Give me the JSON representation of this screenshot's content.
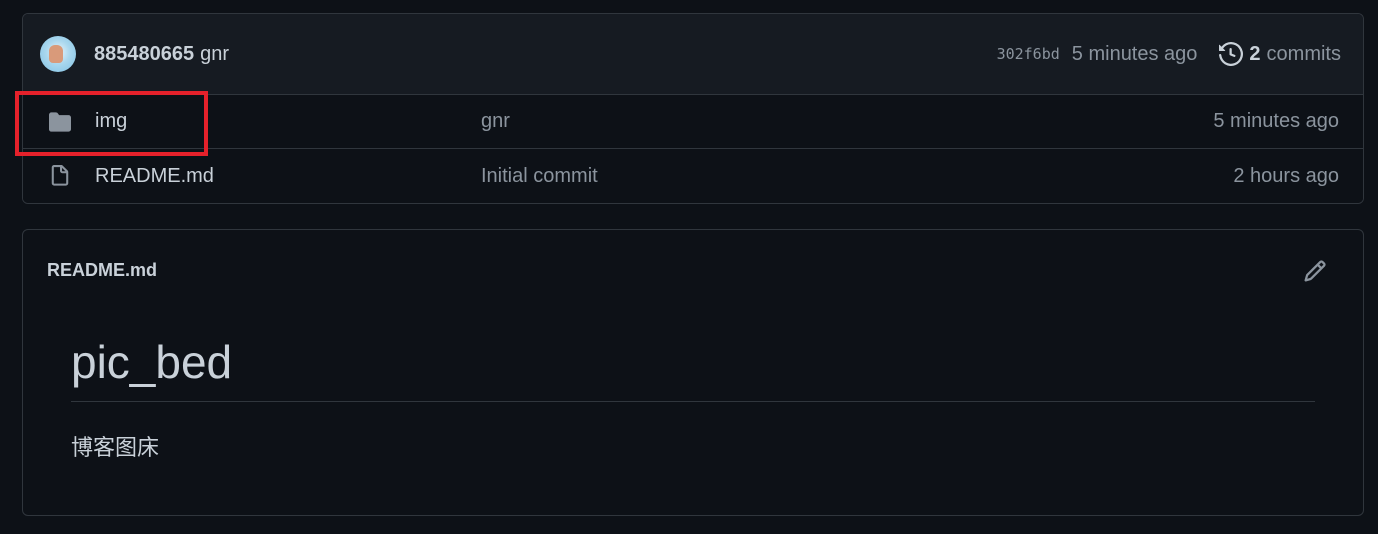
{
  "commit": {
    "author": "885480665",
    "message": "gnr",
    "sha": "302f6bd",
    "time": "5 minutes ago",
    "commit_count": "2",
    "commits_label": "commits"
  },
  "files": [
    {
      "name": "img",
      "type": "folder",
      "message": "gnr",
      "age": "5 minutes ago"
    },
    {
      "name": "README.md",
      "type": "file",
      "message": "Initial commit",
      "age": "2 hours ago"
    }
  ],
  "readme": {
    "filename": "README.md",
    "heading": "pic_bed",
    "body": "博客图床"
  },
  "colors": {
    "background": "#0d1117",
    "header_bg": "#161b22",
    "border": "#30363d",
    "muted_text": "#8b949e",
    "highlight": "#e5212b"
  },
  "icons": {
    "history": "history-icon",
    "folder": "folder-icon",
    "file": "file-icon",
    "edit": "pencil-icon"
  }
}
